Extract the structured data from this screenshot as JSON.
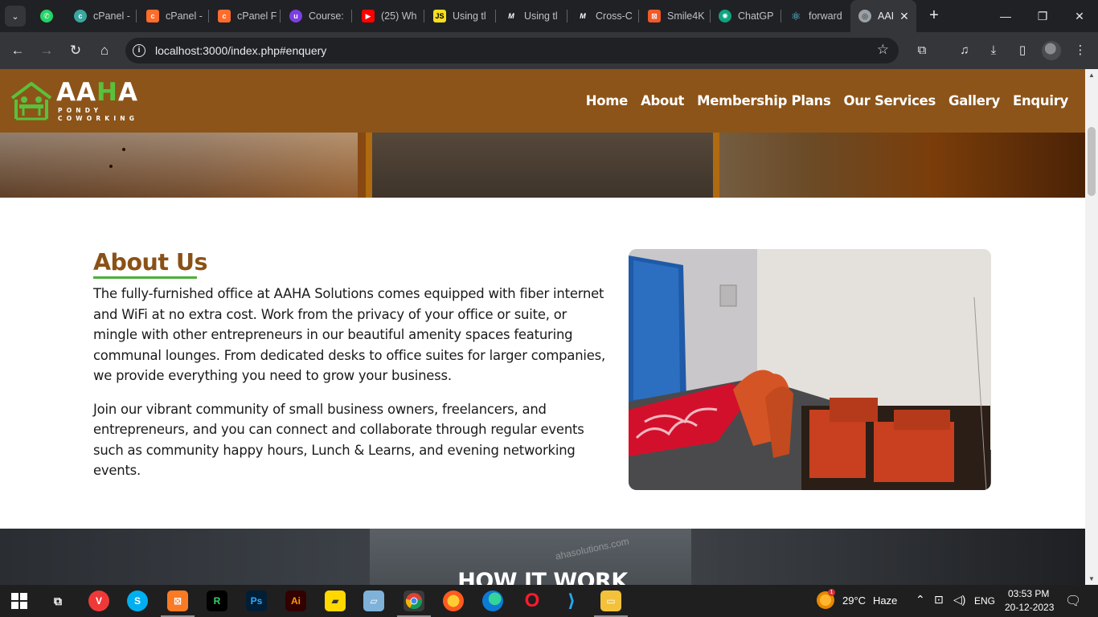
{
  "browser": {
    "tabs": [
      {
        "title": "",
        "icon": "whatsapp-icon",
        "color": "#25d366"
      },
      {
        "title": "cPanel -",
        "icon": "cpanel-icon",
        "color": "#3aa6a0"
      },
      {
        "title": "cPanel -",
        "icon": "cpanel-icon",
        "color": "#ff6c2c"
      },
      {
        "title": "cPanel F",
        "icon": "cpanel-icon",
        "color": "#ff6c2c"
      },
      {
        "title": "Course:",
        "icon": "course-icon",
        "color": "#7b3fe4"
      },
      {
        "title": "(25) Wh",
        "icon": "youtube-icon",
        "color": "#ff0000"
      },
      {
        "title": "Using tl",
        "icon": "js-icon",
        "color": "#f7df1e"
      },
      {
        "title": "Using tl",
        "icon": "medium-icon",
        "color": "#000000"
      },
      {
        "title": "Cross-C",
        "icon": "medium-icon",
        "color": "#000000"
      },
      {
        "title": "Smile4K",
        "icon": "smile-icon",
        "color": "#f05a28"
      },
      {
        "title": "ChatGP",
        "icon": "chatgpt-icon",
        "color": "#10a37f"
      },
      {
        "title": "forward",
        "icon": "react-icon",
        "color": "#61dafb"
      },
      {
        "title": "AAI",
        "icon": "globe-icon",
        "color": "#9aa0a6"
      }
    ],
    "url": "localhost:3000/index.php#enquery",
    "info_glyph": "i"
  },
  "site": {
    "logo": {
      "title_part1": "AA",
      "title_part2": "H",
      "title_part3": "A",
      "line1": "PONDY",
      "line2": "COWORKING"
    },
    "nav": [
      "Home",
      "About",
      "Membership Plans",
      "Our Services",
      "Gallery",
      "Enquiry"
    ],
    "about": {
      "heading": "About Us",
      "paragraph1": "The fully-furnished office at AAHA Solutions comes equipped with fiber internet and WiFi at no extra cost. Work from the privacy of your office or suite, or mingle with other entrepreneurs in our beautiful amenity spaces featuring communal lounges. From dedicated desks to office suites for larger companies, we provide everything you need to grow your business.",
      "paragraph2": "Join our vibrant community of small business owners, freelancers, and entrepreneurs, and you can connect and collaborate through regular events such as community happy hours, Lunch & Learns, and evening networking events."
    },
    "how": {
      "heading": "HOW IT WORK",
      "watermark": "ahasolutions.com"
    }
  },
  "taskbar": {
    "apps": [
      "windows-start-icon",
      "task-view-icon",
      "vivaldi-icon",
      "skype-icon",
      "xampp-icon",
      "rider-icon",
      "photoshop-icon",
      "illustrator-icon",
      "sticky-notes-icon",
      "notepad-icon",
      "chrome-icon",
      "firefox-icon",
      "edge-icon",
      "opera-icon",
      "vscode-icon",
      "file-explorer-icon"
    ],
    "weather_temp": "29°C",
    "weather_desc": "Haze",
    "weather_badge": "1",
    "language": "ENG",
    "time": "03:53 PM",
    "date": "20-12-2023"
  },
  "colors": {
    "header_brown": "#8c5419",
    "heading_brown": "#8a5117",
    "accent_green": "#4caf3a"
  }
}
